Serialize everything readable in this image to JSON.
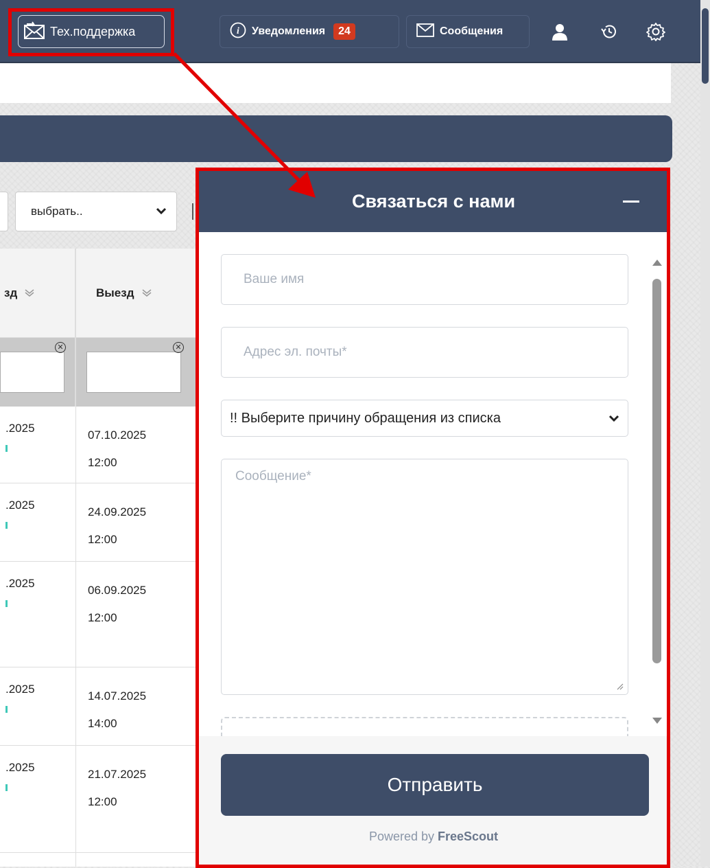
{
  "topbar": {
    "support_label": "Тех.поддержка",
    "notifications_label": "Уведомления",
    "notifications_count": "24",
    "messages_label": "Сообщения"
  },
  "filter": {
    "select_value": "выбрать.."
  },
  "table": {
    "headers": [
      "зд",
      "Выезд"
    ],
    "rows": [
      {
        "col1": ".2025",
        "col2_date": "07.10.2025",
        "col2_time": "12:00"
      },
      {
        "col1": ".2025",
        "col2_date": "24.09.2025",
        "col2_time": "12:00"
      },
      {
        "col1": ".2025",
        "col2_date": "06.09.2025",
        "col2_time": "12:00"
      },
      {
        "col1": ".2025",
        "col2_date": "14.07.2025",
        "col2_time": "14:00"
      },
      {
        "col1": ".2025",
        "col2_date": "21.07.2025",
        "col2_time": "12:00"
      }
    ]
  },
  "widget": {
    "title": "Связаться с нами",
    "name_placeholder": "Ваше имя",
    "email_placeholder": "Адрес эл. почты*",
    "reason_select": "!! Выберите причину обращения из списка",
    "message_placeholder": "Сообщение*",
    "send_label": "Отправить",
    "powered_prefix": "Powered by",
    "powered_brand": "FreeScout"
  },
  "colors": {
    "header_navy": "#3e4d68",
    "highlight_red": "#e10000",
    "badge_red": "#d23a1f"
  }
}
